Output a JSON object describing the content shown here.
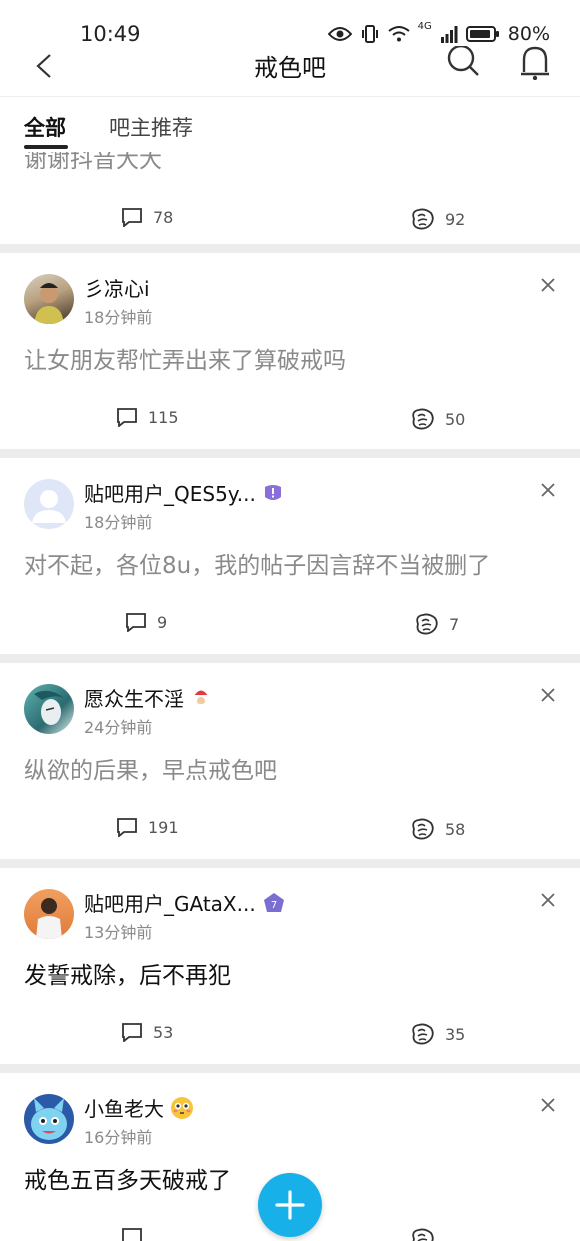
{
  "status_bar": {
    "time": "10:49",
    "network": "4G",
    "battery": "80%"
  },
  "header": {
    "title": "戒色吧"
  },
  "tabs": [
    {
      "label": "全部",
      "active": true
    },
    {
      "label": "吧主推荐",
      "active": false
    }
  ],
  "partial_post": {
    "title": "谢谢抖音大大",
    "comments": "78",
    "likes": "92"
  },
  "posts": [
    {
      "username": "彡凉心i",
      "time": "18分钟前",
      "title": "让女朋友帮忙弄出来了算破戒吗",
      "comments": "115",
      "likes": "50",
      "badge": ""
    },
    {
      "username": "贴吧用户_QES5y...",
      "time": "18分钟前",
      "title": "对不起，各位8u，我的帖子因言辞不当被删了",
      "comments": "9",
      "likes": "7",
      "badge": "level-badge-icon"
    },
    {
      "username": "愿众生不淫",
      "time": "24分钟前",
      "title": "纵欲的后果，早点戒色吧",
      "comments": "191",
      "likes": "58",
      "badge": "santa-emoji"
    },
    {
      "username": "贴吧用户_GAtaX...",
      "time": "13分钟前",
      "title": "发誓戒除，后不再犯",
      "comments": "53",
      "likes": "35",
      "badge": "level-badge-icon"
    },
    {
      "username": "小鱼老大",
      "time": "16分钟前",
      "title": "戒色五百多天破戒了",
      "comments": "",
      "likes": "",
      "badge": "flushed-emoji"
    }
  ],
  "colors": {
    "accent": "#18b0e8",
    "meta_text": "#8a8a8a",
    "divider": "#ececec"
  }
}
